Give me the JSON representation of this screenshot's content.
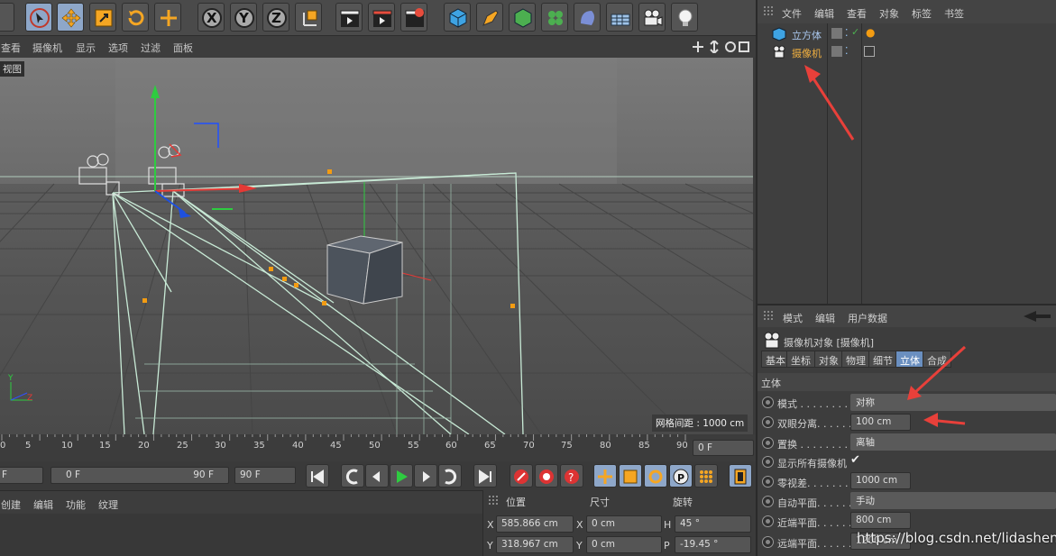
{
  "toolbar": {
    "axis_buttons": [
      "X",
      "Y",
      "Z"
    ]
  },
  "viewport": {
    "menu": [
      "查看",
      "摄像机",
      "显示",
      "选项",
      "过滤",
      "面板"
    ],
    "view_label": "视图",
    "grid_spacing_label": "网格间距 : 1000 cm"
  },
  "timeline": {
    "ticks": [
      "0",
      "5",
      "10",
      "15",
      "20",
      "25",
      "30",
      "35",
      "40",
      "45",
      "50",
      "55",
      "60",
      "65",
      "70",
      "75",
      "80",
      "85",
      "90"
    ],
    "current_frame": "0 F",
    "start_field": "F",
    "range_start": "0 F",
    "range_end": "90 F",
    "end_field": "90 F"
  },
  "bottom_menu": [
    "创建",
    "编辑",
    "功能",
    "纹理"
  ],
  "coords": {
    "headers": [
      "位置",
      "尺寸",
      "旋转"
    ],
    "rows": [
      {
        "axis": "X",
        "pos": "585.866 cm",
        "size_axis": "X",
        "size": "0 cm",
        "rot_axis": "H",
        "rot": "45 °"
      },
      {
        "axis": "Y",
        "pos": "318.967 cm",
        "size_axis": "Y",
        "size": "0 cm",
        "rot_axis": "P",
        "rot": "-19.45 °"
      }
    ]
  },
  "object_manager": {
    "menu": [
      "文件",
      "编辑",
      "查看",
      "对象",
      "标签",
      "书签"
    ],
    "objects": [
      {
        "name": "立方体",
        "color": "#a9c7ee"
      },
      {
        "name": "摄像机",
        "color": "#f0b040"
      }
    ]
  },
  "attribute_manager": {
    "menu": [
      "模式",
      "编辑",
      "用户数据"
    ],
    "title": "摄像机对象 [摄像机]",
    "tabs": [
      "基本",
      "坐标",
      "对象",
      "物理",
      "细节",
      "立体",
      "合成"
    ],
    "active_tab": "立体",
    "section": "立体",
    "params": [
      {
        "label": "模式",
        "dots": " . . . . . . . . . . . .",
        "value": "对称",
        "type": "dropdown"
      },
      {
        "label": "双眼分离",
        "dots": ". . . . . . . .",
        "value": "100 cm",
        "type": "number"
      },
      {
        "label": "置换",
        "dots": " . . . . . . . . . . . .",
        "value": "离轴",
        "type": "dropdown"
      },
      {
        "label": "显示所有摄像机",
        "dots": "",
        "value": "✔",
        "type": "check"
      },
      {
        "label": "零视差",
        "dots": ". . . . . . . . . .",
        "value": "1000 cm",
        "type": "number"
      },
      {
        "label": "自动平面",
        "dots": ". . . . . . . .",
        "value": "手动",
        "type": "dropdown"
      },
      {
        "label": "近端平面",
        "dots": ". . . . . . . .",
        "value": "800 cm",
        "type": "number"
      },
      {
        "label": "远端平面",
        "dots": ". . . . . . . .",
        "value": "1200 cm",
        "type": "number"
      }
    ]
  },
  "watermark": "https://blog.csdn.net/lidashent",
  "colors": {
    "accent": "#6a8fc0",
    "highlight_button": "#8ea7c9",
    "annotation_arrow": "#e8403a"
  }
}
